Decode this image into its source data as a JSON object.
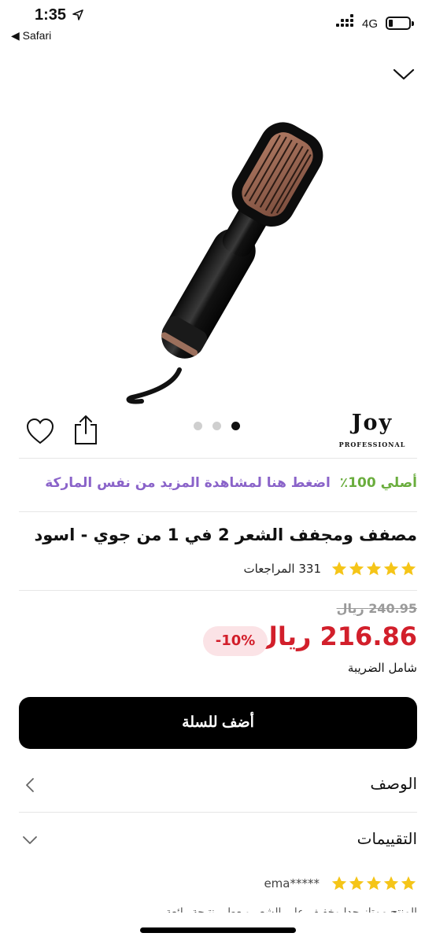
{
  "status_bar": {
    "time": "1:35",
    "back_app": "◀ Safari",
    "network": "4G",
    "battery_level": 0.2
  },
  "icons": {
    "location": "location-arrow-icon",
    "collapse": "chevron-down-icon",
    "wishlist": "heart-icon",
    "share": "share-icon",
    "star": "star-icon"
  },
  "colors": {
    "price_red": "#d21f2b",
    "authentic_green": "#6aad3d",
    "link_purple": "#8a63c9",
    "star_yellow": "#f5c518",
    "button_black": "#000000"
  },
  "gallery": {
    "image_count": 3,
    "active_index": 2
  },
  "brand": {
    "name": "Joy",
    "tagline": "PROFESSIONAL"
  },
  "authentic": {
    "label": "أصلي 100٪",
    "link": "اضغط هنا لمشاهدة المزيد من نفس الماركة"
  },
  "product": {
    "title": "مصفف ومجفف الشعر 2 في 1 من جوي - اسود",
    "rating": 5,
    "review_count_label": "331 المراجعات"
  },
  "pricing": {
    "old_price": "240.95 ريال",
    "price": "216.86 ريال",
    "discount": "-10%",
    "tax_note": "شامل الضريبة"
  },
  "cta": {
    "add_to_cart": "أضف للسلة"
  },
  "sections": {
    "description": "الوصف",
    "reviews": "التقييمات"
  },
  "first_review": {
    "rating": 5,
    "reviewer": "ema*****",
    "snippet": "المنتج ممتاز جدا وخفيف على الشعر ويعطي نتيجة رائعة"
  }
}
